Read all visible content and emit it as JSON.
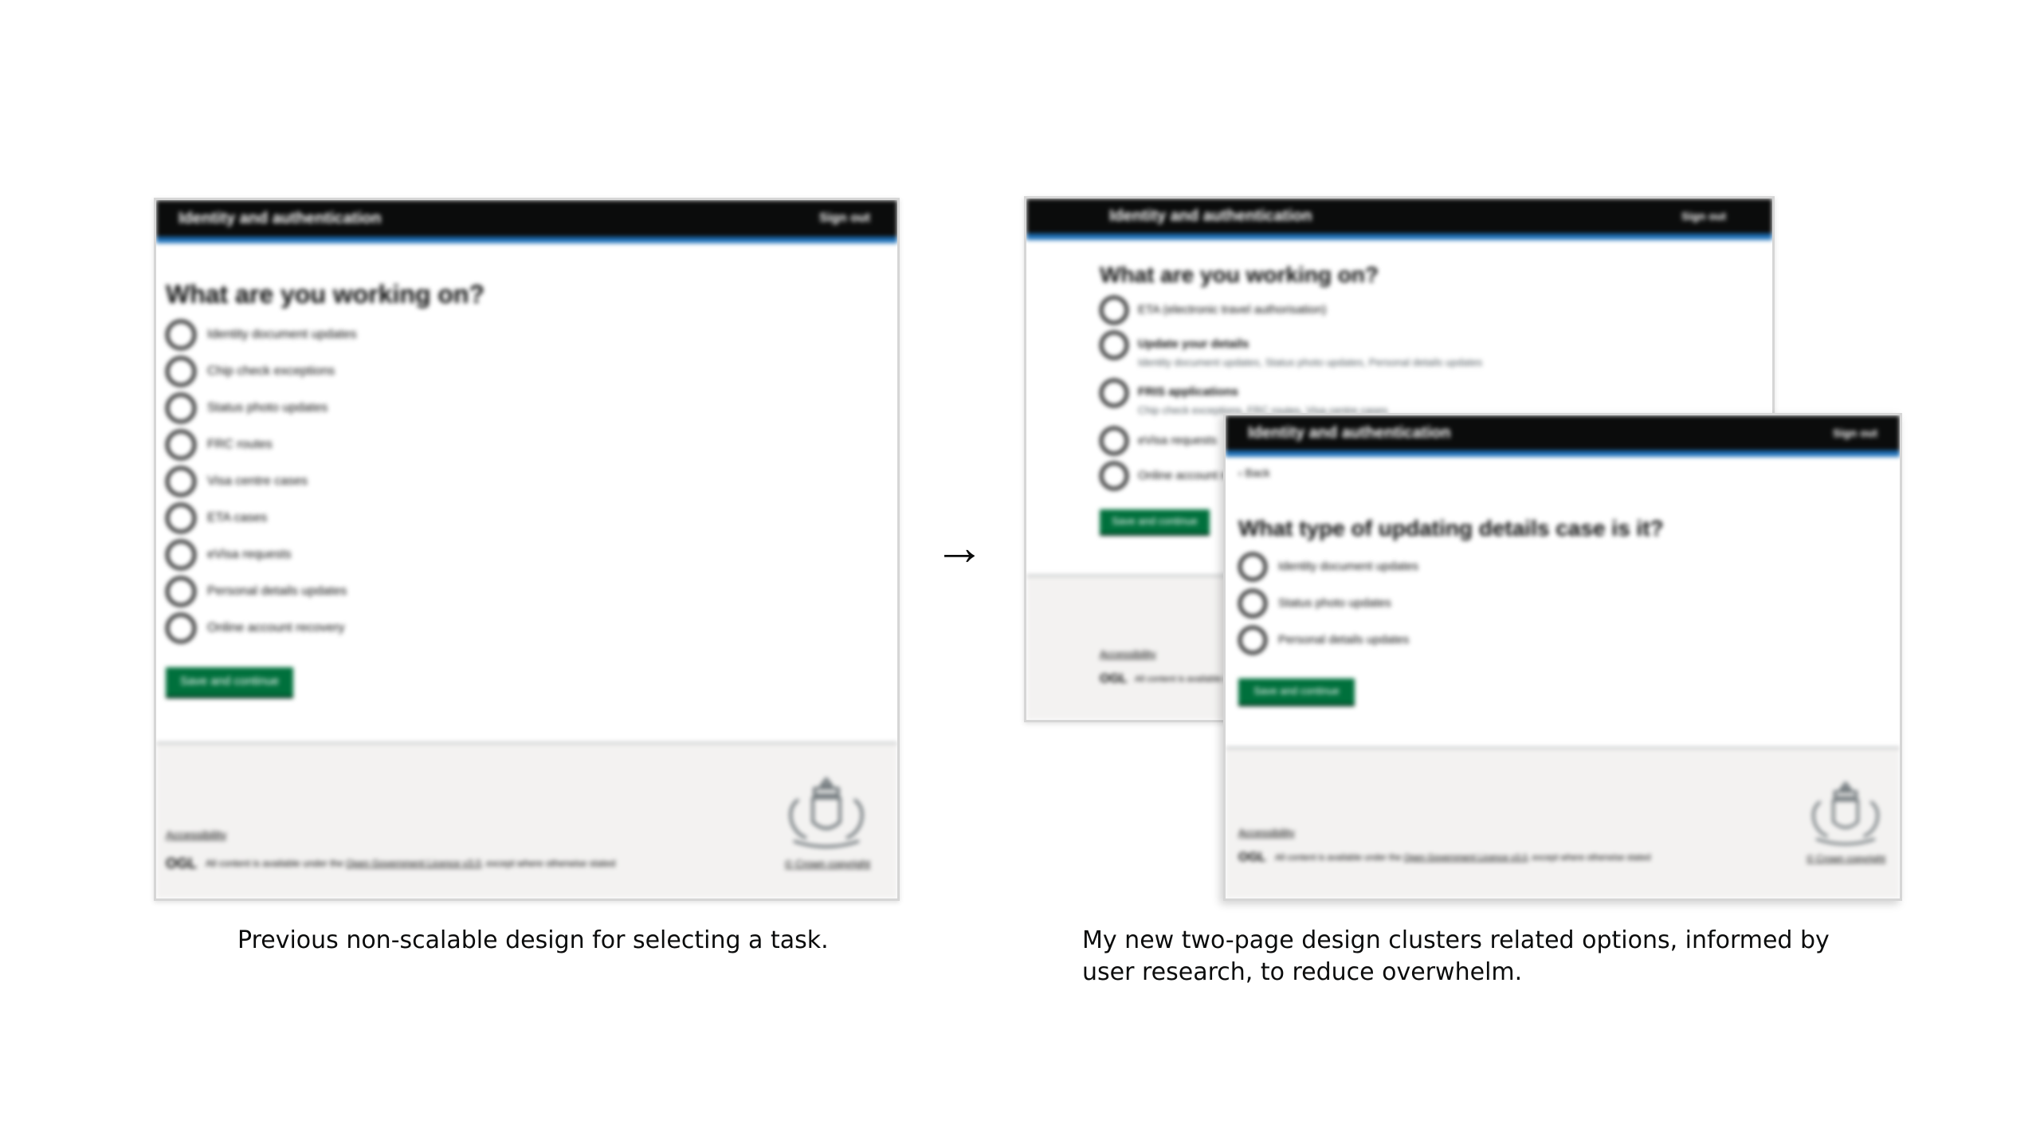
{
  "old_design": {
    "header": {
      "service_name": "Identity and authentication",
      "sign_out": "Sign out"
    },
    "heading": "What are you working on?",
    "options": [
      "Identity document updates",
      "Chip check exceptions",
      "Status photo updates",
      "FRC routes",
      "Visa centre cases",
      "ETA cases",
      "eVisa requests",
      "Personal details updates",
      "Online account recovery"
    ],
    "button": "Save and continue",
    "footer": {
      "accessibility": "Accessibility",
      "ogl": "OGL",
      "licence_prefix": "All content is available under the",
      "licence_link": "Open Government Licence v3.0",
      "licence_suffix": ", except where otherwise stated",
      "copyright": "© Crown copyright"
    }
  },
  "new_page_one": {
    "header": {
      "service_name": "Identity and authentication",
      "sign_out": "Sign out"
    },
    "heading": "What are you working on?",
    "options": [
      {
        "label": "ETA (electronic travel authorisation)",
        "hint": ""
      },
      {
        "label": "Update your details",
        "hint": "Identity document updates, Status photo updates, Personal details updates"
      },
      {
        "label": "FRIS applications",
        "hint": "Chip check exceptions, FRC routes, Visa centre cases"
      },
      {
        "label": "eVisa requests",
        "hint": ""
      },
      {
        "label": "Online account recovery",
        "hint": ""
      }
    ],
    "button": "Save and continue",
    "footer": {
      "accessibility": "Accessibility",
      "ogl": "OGL",
      "licence_prefix": "All content is available under the"
    }
  },
  "new_page_two": {
    "header": {
      "service_name": "Identity and authentication",
      "sign_out": "Sign out"
    },
    "back": "‹ Back",
    "heading": "What type of updating details case is it?",
    "options": [
      "Identity document updates",
      "Status photo updates",
      "Personal details updates"
    ],
    "button": "Save and continue",
    "footer": {
      "accessibility": "Accessibility",
      "ogl": "OGL",
      "licence_prefix": "All content is available under the",
      "licence_link": "Open Government Licence v3.0",
      "licence_suffix": ", except where otherwise stated",
      "copyright": "© Crown copyright"
    }
  },
  "arrow": "→",
  "captions": {
    "left": "Previous non-scalable design for selecting a task.",
    "right": "My new two-page design clusters related options, informed by user research, to reduce overwhelm."
  }
}
